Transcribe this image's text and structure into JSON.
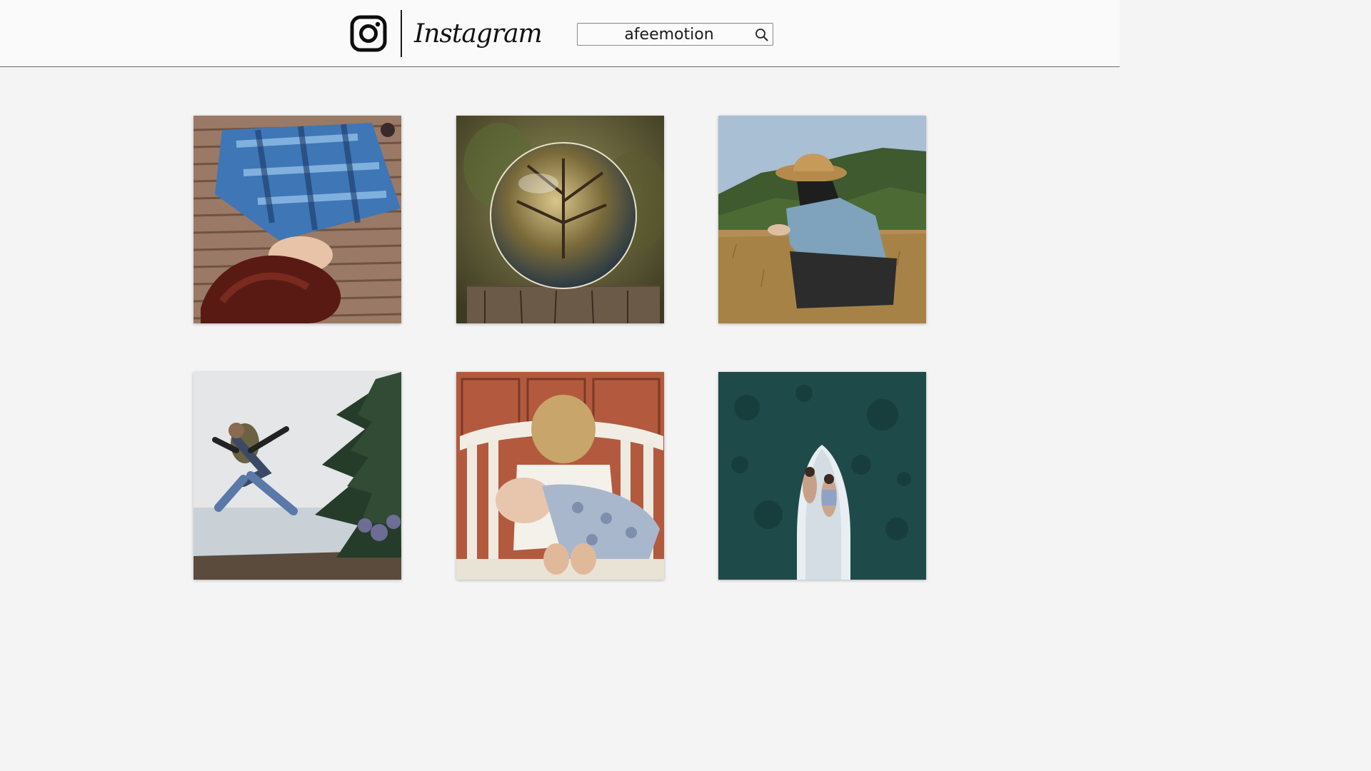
{
  "header": {
    "brand": "Instagram",
    "search": {
      "value": "afeemotion"
    }
  },
  "posts": [
    {
      "icon": "photo-woman-lying-on-deck"
    },
    {
      "icon": "photo-glass-ball-on-stump"
    },
    {
      "icon": "photo-woman-straw-hat-field"
    },
    {
      "icon": "photo-person-jumping-outdoors"
    },
    {
      "icon": "photo-child-kissing-baby"
    },
    {
      "icon": "photo-couple-on-boat-aerial"
    }
  ],
  "colors": {
    "background": "#f4f4f4",
    "header_bg": "#fafafa",
    "text": "#111111"
  }
}
